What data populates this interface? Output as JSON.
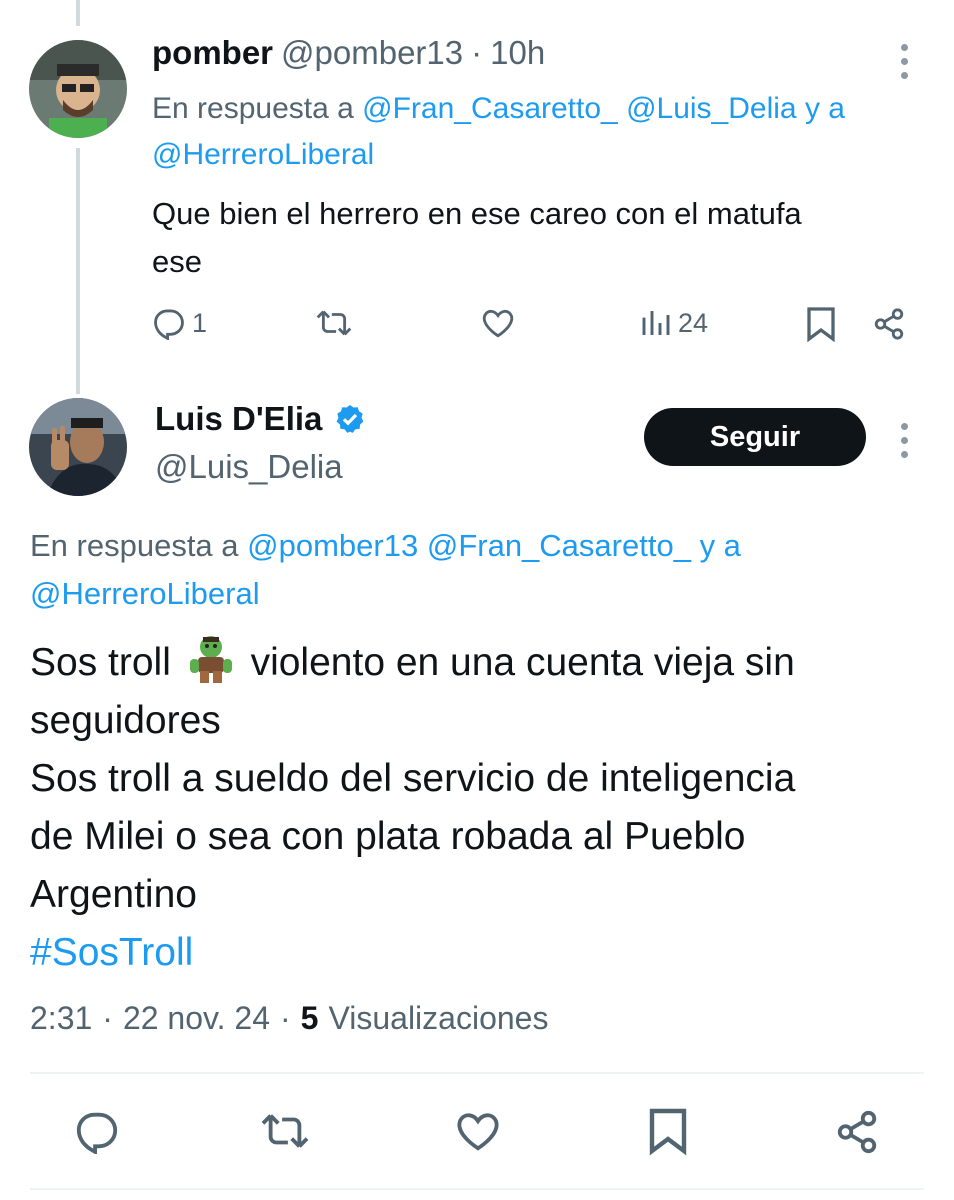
{
  "tweet1": {
    "name": "pomber",
    "handle": "@pomber13",
    "sep": "·",
    "time": "10h",
    "reply_prefix": "En respuesta a",
    "reply_mention1": "@Fran_Casaretto_",
    "reply_mention2": "@Luis_Delia",
    "reply_joiner": "y a",
    "reply_mention3": "@HerreroLiberal",
    "text_line1": "Que bien el herrero en ese careo con el matufa",
    "text_line2": "ese",
    "reply_count": "1",
    "views_count": "24"
  },
  "tweet2": {
    "name": "Luis D'Elia",
    "handle": "@Luis_Delia",
    "follow_label": "Seguir",
    "reply_prefix": "En respuesta a",
    "reply_mention1": "@pomber13",
    "reply_mention2": "@Fran_Casaretto_",
    "reply_joiner": "y a",
    "reply_mention3": "@HerreroLiberal",
    "line1_a": "Sos troll",
    "line1_b": "violento en una cuenta vieja sin",
    "line2": "seguidores",
    "line3": "Sos troll a sueldo del servicio de inteligencia",
    "line4": "de Milei o sea con plata robada al Pueblo",
    "line5": "Argentino",
    "hashtag": "#SosTroll",
    "time": "2:31",
    "sep": "·",
    "date": "22 nov. 24",
    "views_count": "5",
    "views_label": "Visualizaciones"
  },
  "icons": {
    "reply": "reply-icon",
    "retweet": "retweet-icon",
    "like": "heart-icon",
    "views": "views-icon",
    "bookmark": "bookmark-icon",
    "share": "share-icon",
    "verified": "verified-badge-icon",
    "more": "more-options-icon"
  },
  "colors": {
    "accent": "#1d9bf0",
    "text": "#0f1419",
    "secondary": "#536471",
    "thread_line": "#cfd9de",
    "follow_button": "#0f1419"
  }
}
